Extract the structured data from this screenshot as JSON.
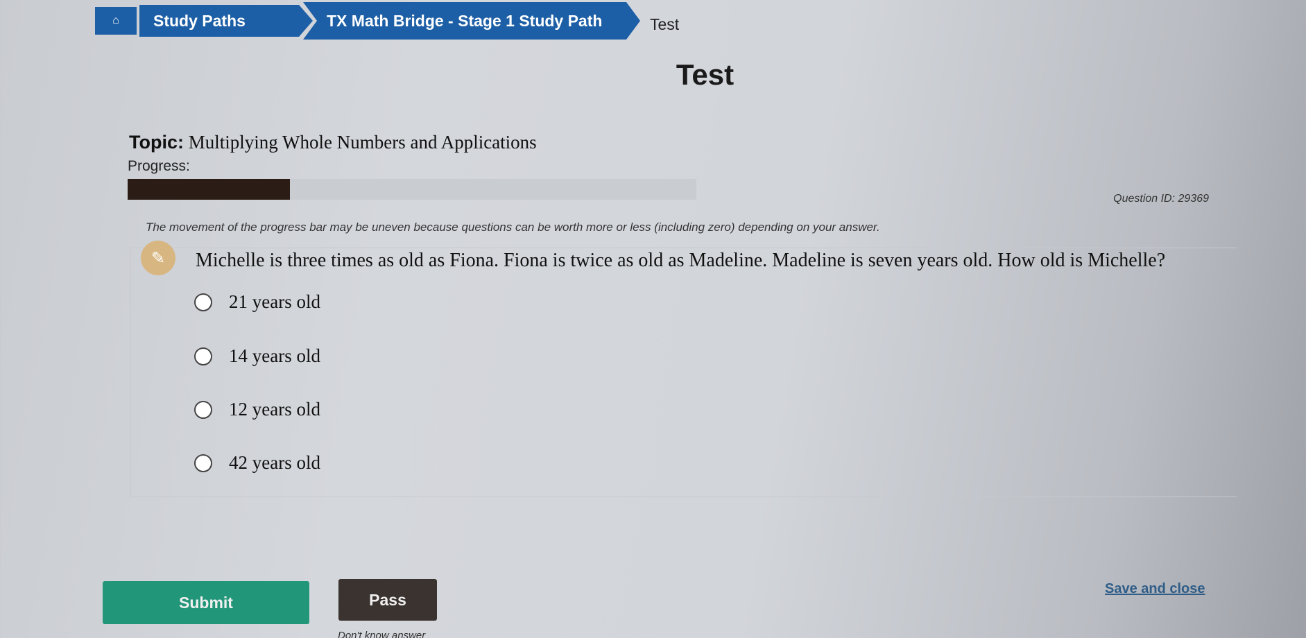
{
  "breadcrumb": {
    "home_icon": "home-icon",
    "items": [
      "Study Paths",
      "TX Math Bridge - Stage 1 Study Path"
    ],
    "current": "Test"
  },
  "page": {
    "title": "Test",
    "topic_label": "Topic:",
    "topic": "Multiplying Whole Numbers and Applications"
  },
  "progress": {
    "label": "Progress:",
    "value_fraction": 0.285,
    "notice": "The movement of the progress bar may be uneven because questions can be worth more or less (including zero) depending on your answer."
  },
  "question": {
    "id_text": "Question ID: 29369",
    "icon": "pencil-icon",
    "text": "Michelle is three times as old as Fiona. Fiona is twice as old as Madeline. Madeline is seven years old. How old is Michelle?",
    "options": [
      "21 years old",
      "14 years old",
      "12 years old",
      "42 years old"
    ]
  },
  "actions": {
    "submit": "Submit",
    "pass": "Pass",
    "pass_hint": "Don't know answer",
    "save_close": "Save and close"
  },
  "colors": {
    "breadcrumb": "#1d5fa6",
    "submit": "#229678",
    "pass": "#3b3330",
    "progress_fill": "#2b1c15",
    "link": "#2f5d88"
  }
}
